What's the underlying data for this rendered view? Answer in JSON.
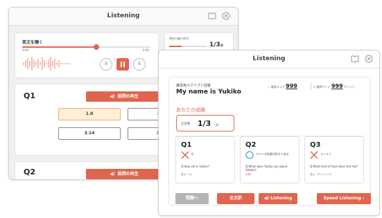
{
  "back_window": {
    "title": "Listening",
    "audio": {
      "label": "英文を聴く",
      "time_start": "0:00",
      "time_end": "0:00",
      "progress": 0.58,
      "rewind_label": "5",
      "forward_label": "5"
    },
    "progress_panel": {
      "label": "現在の進行状況",
      "value": "1/3",
      "unit": "問",
      "progress": 0.33
    },
    "q1": {
      "label": "Q1",
      "play_label": "設問の再生",
      "answers": [
        "1.0",
        "2",
        "3.14",
        "3."
      ]
    },
    "q2": {
      "label": "Q2",
      "play_label": "設問の再生"
    }
  },
  "front_window": {
    "title": "Listening",
    "header": {
      "caption": "練習用スクリプト回答",
      "title": "My name is Yukiko",
      "score_label": "獲得スコア",
      "score_value": "999",
      "pages_label": "獲得ページ",
      "pages_value": "999",
      "pages_unit": "ポイント"
    },
    "result": {
      "heading": "あなたの成績",
      "correct_label": "正答数",
      "correct_value": "1/3",
      "correct_unit": "問"
    },
    "questions": [
      {
        "label": "Q1",
        "result": "wrong",
        "answer": "6",
        "question": "Q.How old is Yukiko?",
        "sub": "答え：14"
      },
      {
        "label": "Q2",
        "result": "correct",
        "answer": "アメリカ料理が好きである",
        "question": "Q.What does Yukiko say about Satoko?",
        "sub": "正解！"
      },
      {
        "label": "Q3",
        "result": "wrong",
        "answer": "ラーメン",
        "question": "Q.What kind of food does she like?",
        "sub": "答え：ホットドッグ"
      }
    ],
    "buttons": {
      "prev": "問題へ",
      "full_text": "全文訳",
      "listening": "Listening",
      "speed": "Speed Listening"
    },
    "colors": {
      "accent": "#e0654f",
      "wrong": "#e0654f",
      "correct": "#4a9fd8"
    }
  }
}
